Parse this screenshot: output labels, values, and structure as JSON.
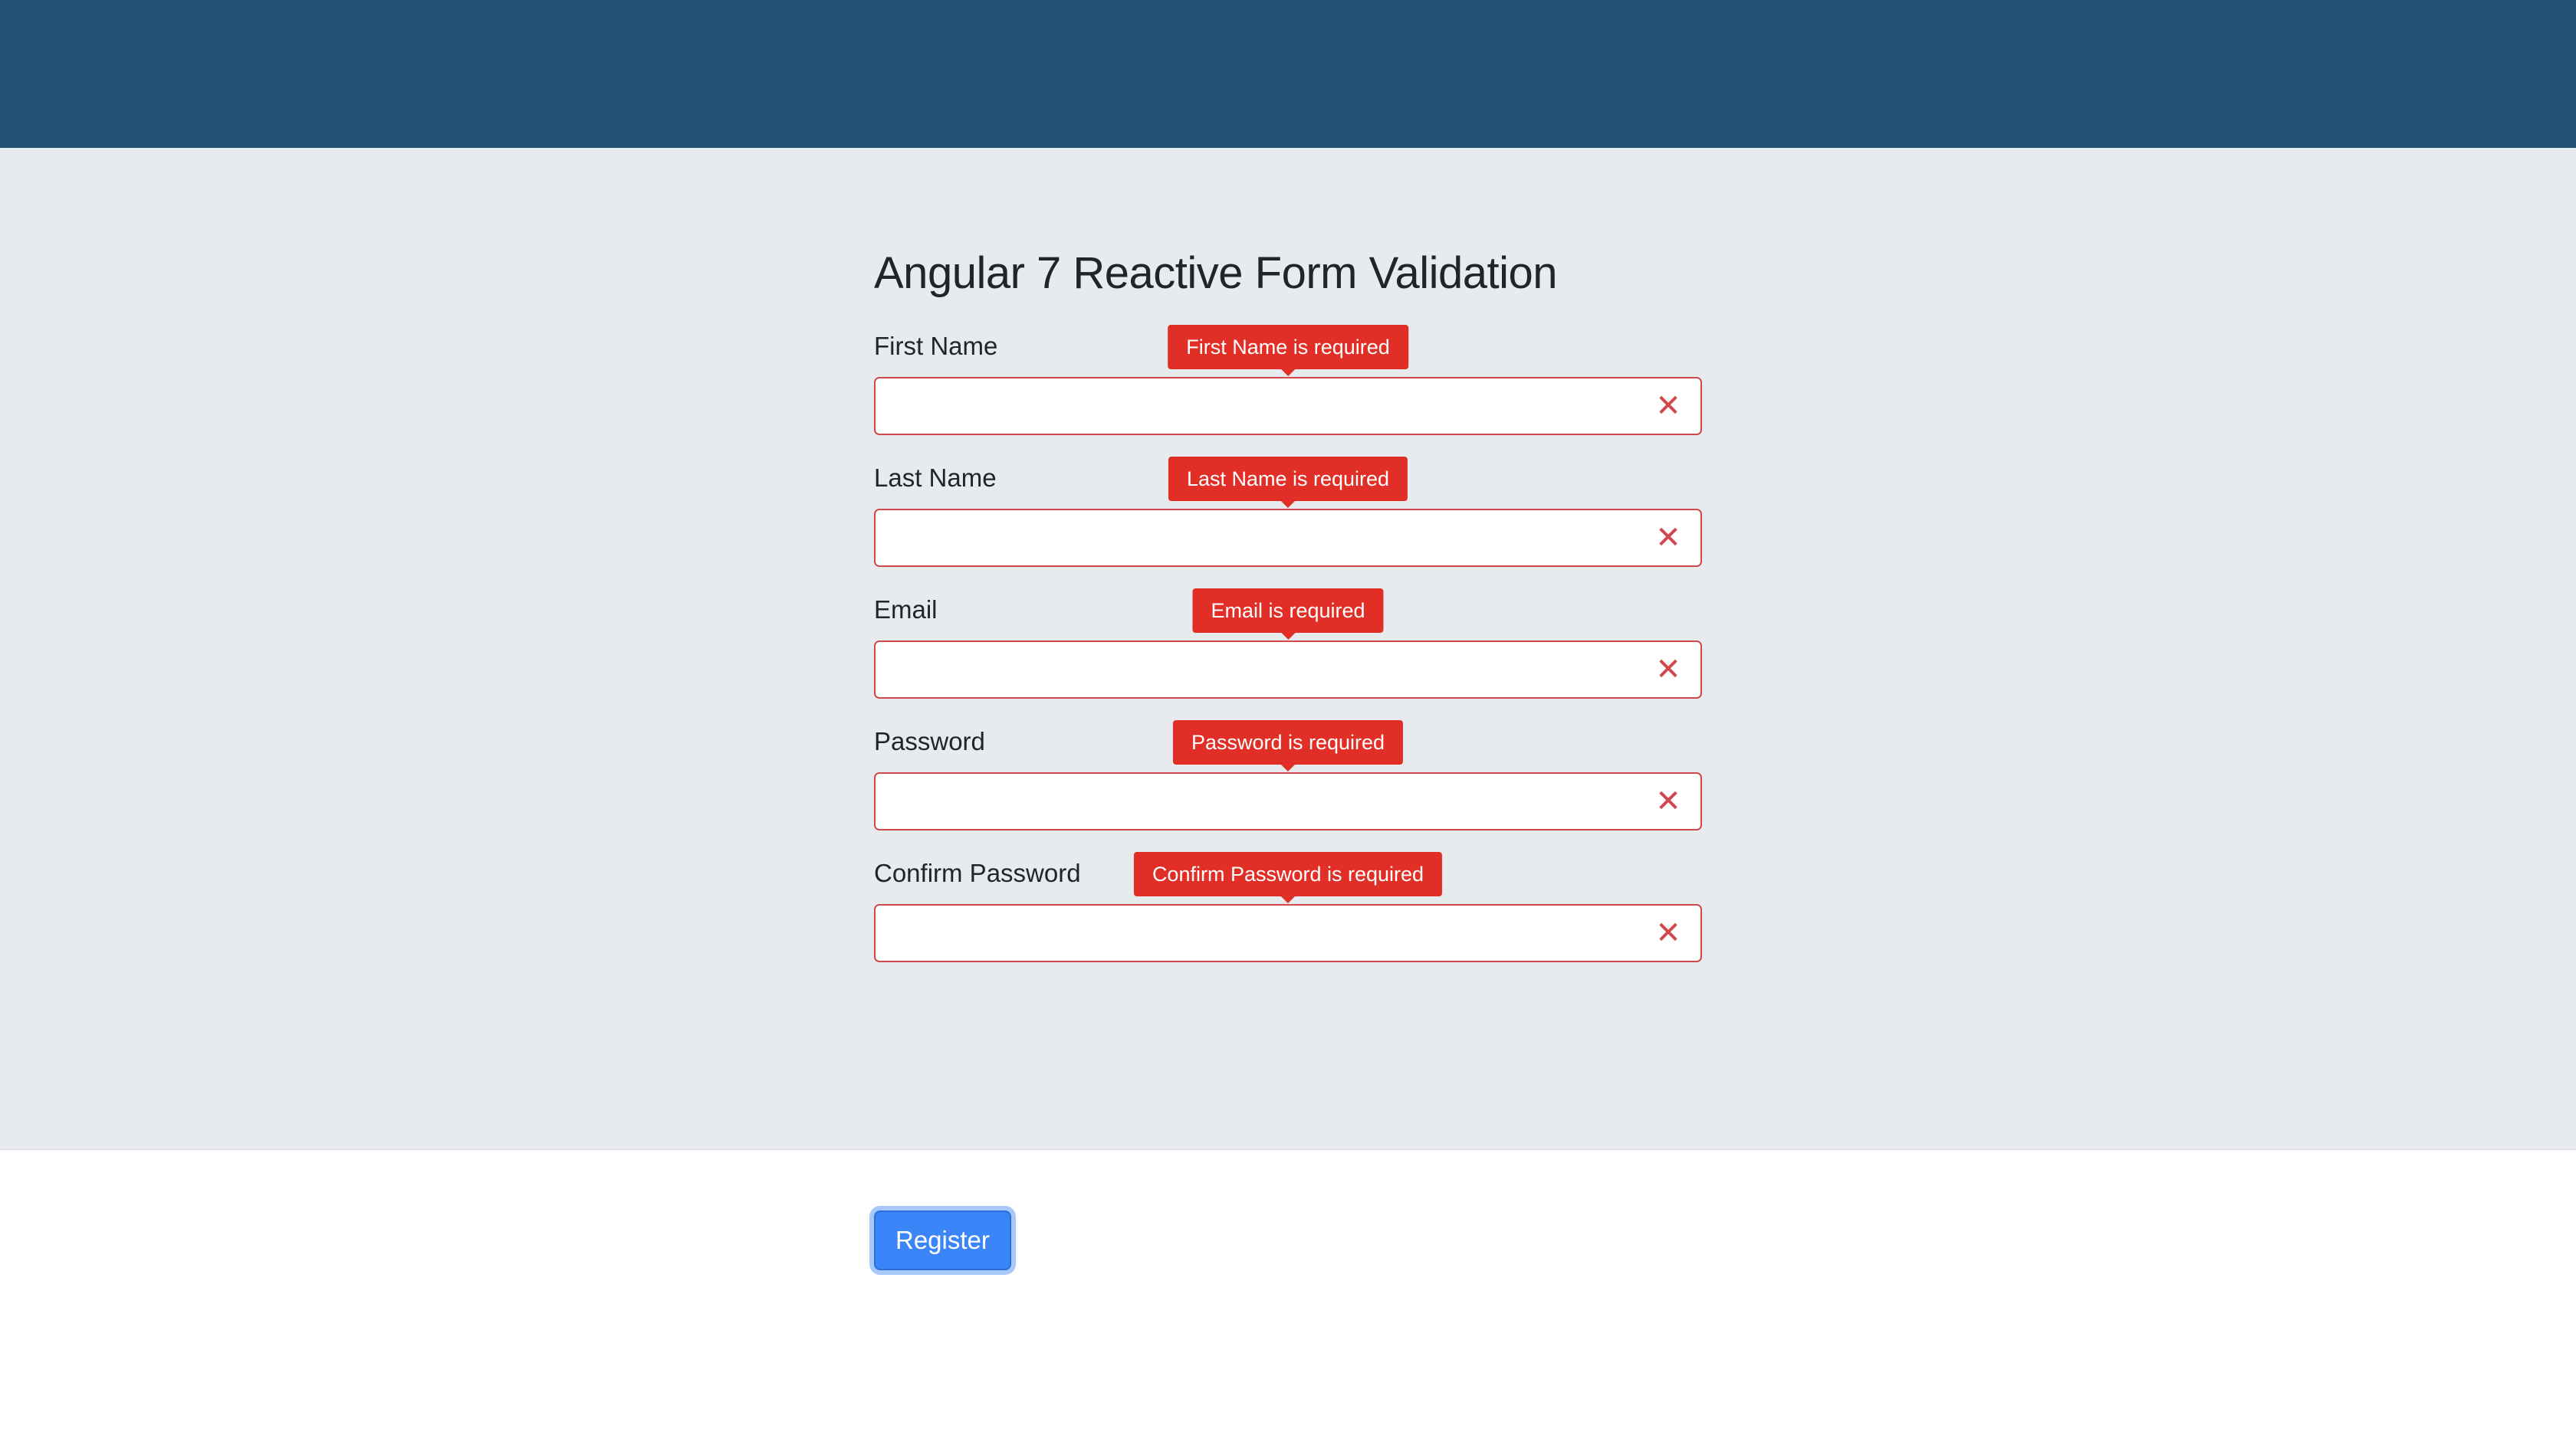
{
  "page": {
    "title": "Angular 7 Reactive Form Validation"
  },
  "form": {
    "fields": [
      {
        "label": "First Name",
        "error": "First Name is required",
        "value": ""
      },
      {
        "label": "Last Name",
        "error": "Last Name is required",
        "value": ""
      },
      {
        "label": "Email",
        "error": "Email is required",
        "value": ""
      },
      {
        "label": "Password",
        "error": "Password is required",
        "value": ""
      },
      {
        "label": "Confirm Password",
        "error": "Confirm Password is required",
        "value": ""
      }
    ],
    "register_label": "Register"
  },
  "icons": {
    "invalid": "close-icon"
  },
  "colors": {
    "header": "#215273",
    "background": "#e8ebee",
    "error": "#e12e26",
    "invalid_border": "#d2464c",
    "primary": "#3a85f7"
  }
}
